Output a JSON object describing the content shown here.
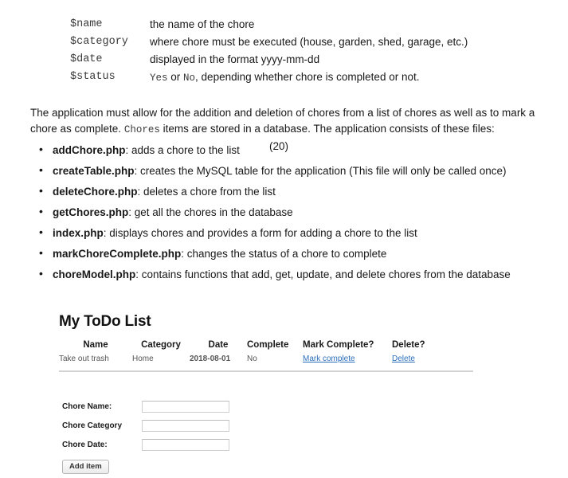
{
  "variables": {
    "rows": [
      {
        "name": "$name",
        "desc": "the name of the chore"
      },
      {
        "name": "$category",
        "desc": "where chore must be executed (house, garden, shed, garage, etc.)"
      },
      {
        "name": "$date",
        "desc": "displayed in the format yyyy-mm-dd"
      },
      {
        "name": "$status",
        "desc_pre": "Yes",
        "desc_mid": " or ",
        "desc_code2": "No",
        "desc_post": ", depending whether chore is completed or not."
      }
    ]
  },
  "intro": {
    "part1": "The application must allow for the addition and deletion of chores from a list of chores as well as to mark a chore as complete. ",
    "code": "Chores",
    "part2": " items are stored in a database. The application consists of these files:",
    "marks": "(20)"
  },
  "files": [
    {
      "name": "addChore.php",
      "desc": ": adds a chore to the list"
    },
    {
      "name": "createTable.php",
      "desc": ": creates the MySQL table for the application (This file will only be called once)"
    },
    {
      "name": "deleteChore.php",
      "desc": ": deletes a chore from the list"
    },
    {
      "name": "getChores.php",
      "desc": ": get all the chores in the database"
    },
    {
      "name": "index.php",
      "desc": ": displays chores and provides a form for adding a chore to the list"
    },
    {
      "name": "markChoreComplete.php",
      "desc": ": changes the status of a chore to complete"
    },
    {
      "name": "choreModel.php",
      "desc": ": contains functions that add, get, update, and delete chores from the database"
    }
  ],
  "app": {
    "title": "My ToDo List",
    "table": {
      "headers": [
        "Name",
        "Category",
        "Date",
        "Complete",
        "Mark Complete?",
        "Delete?"
      ],
      "rows": [
        {
          "name": "Take out trash",
          "category": "Home",
          "date": "2018-08-01",
          "complete": "No",
          "mark_link": "Mark complete",
          "delete_link": "Delete"
        }
      ]
    },
    "form": {
      "fields": [
        {
          "label": "Chore Name:",
          "value": ""
        },
        {
          "label": "Chore Category",
          "value": ""
        },
        {
          "label": "Chore Date:",
          "value": ""
        }
      ],
      "submit_label": "Add item"
    },
    "link_color": "#2a6ebb"
  }
}
